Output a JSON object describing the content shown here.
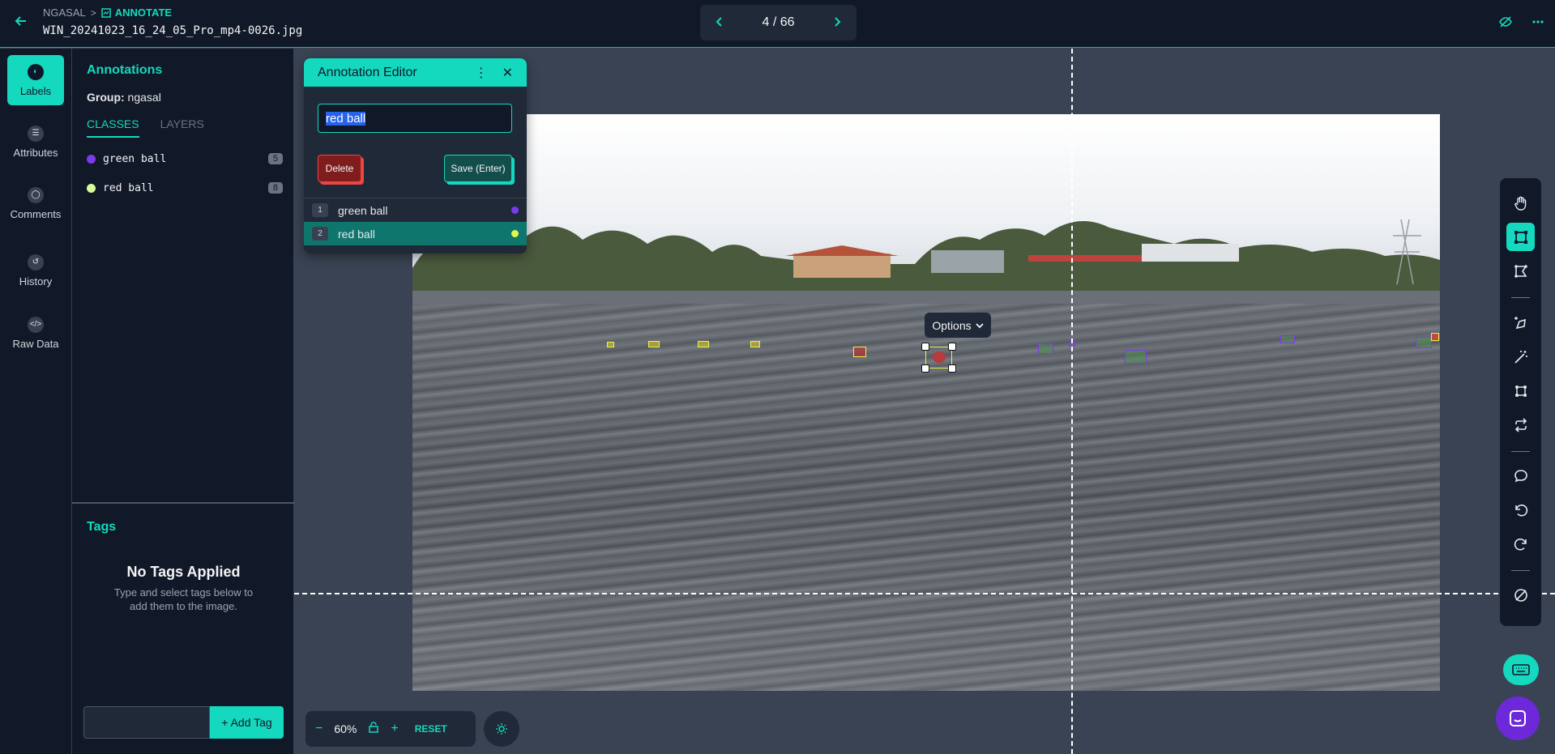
{
  "header": {
    "breadcrumb_root": "NGASAL",
    "breadcrumb_sep": ">",
    "breadcrumb_active": "ANNOTATE",
    "filename": "WIN_20241023_16_24_05_Pro_mp4-0026.jpg",
    "pager": "4 / 66"
  },
  "rail": {
    "items": [
      {
        "label": "Labels",
        "icon": "labels-icon"
      },
      {
        "label": "Attributes",
        "icon": "list-icon"
      },
      {
        "label": "Comments",
        "icon": "comment-icon"
      },
      {
        "label": "History",
        "icon": "history-icon"
      },
      {
        "label": "Raw Data",
        "icon": "code-icon"
      }
    ]
  },
  "annotations": {
    "title": "Annotations",
    "group_label": "Group:",
    "group_value": "ngasal",
    "tabs": [
      "CLASSES",
      "LAYERS"
    ],
    "classes": [
      {
        "name": "green ball",
        "count": "5",
        "color": "#7c3aed"
      },
      {
        "name": "red ball",
        "count": "8",
        "color": "#d9f99d"
      }
    ]
  },
  "tags": {
    "title": "Tags",
    "empty_title": "No Tags Applied",
    "empty_text": "Type and select tags below to add them to the image.",
    "input_value": "",
    "add_button": "+ Add Tag"
  },
  "editor": {
    "title": "Annotation Editor",
    "input_value": "red ball",
    "delete_label": "Delete",
    "save_label": "Save (Enter)",
    "options": [
      {
        "hotkey": "1",
        "name": "green ball",
        "color": "#7c3aed"
      },
      {
        "hotkey": "2",
        "name": "red ball",
        "color": "#e5f54c"
      }
    ]
  },
  "canvas": {
    "options_label": "Options"
  },
  "zoom": {
    "value": "60%",
    "reset_label": "RESET"
  },
  "colors": {
    "accent": "#14d9be",
    "panel": "#111827",
    "canvas_bg": "#394353"
  }
}
